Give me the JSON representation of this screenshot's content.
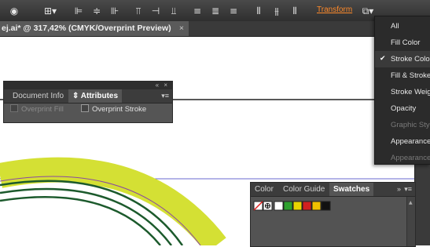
{
  "toolbar": {
    "transform_label": "Transform",
    "icons": [
      "globe-icon",
      "arrange-icon",
      "align-left-icon",
      "align-hcenter-icon",
      "align-right-icon",
      "align-top-icon",
      "align-vcenter-icon",
      "align-bottom-icon",
      "distribute-top-icon",
      "distribute-vcenter-icon",
      "distribute-bottom-icon",
      "distribute-left-icon",
      "distribute-hcenter-icon",
      "distribute-right-icon",
      "transform-options-icon"
    ]
  },
  "document": {
    "tab_title": "ej.ai* @ 317,42% (CMYK/Overprint Preview)",
    "close_glyph": "×"
  },
  "attributes_panel": {
    "tabs": [
      "Document Info",
      "Attributes"
    ],
    "active_tab": "Attributes",
    "overprint_fill_label": "Overprint Fill",
    "overprint_fill_enabled": false,
    "overprint_stroke_label": "Overprint Stroke",
    "overprint_stroke_checked": false
  },
  "dropdown_menu": {
    "items": [
      {
        "label": "All",
        "checked": false,
        "disabled": false
      },
      {
        "label": "Fill Color",
        "checked": false,
        "disabled": false
      },
      {
        "label": "Stroke Color",
        "checked": true,
        "disabled": false
      },
      {
        "label": "Fill & Stroke",
        "checked": false,
        "disabled": false
      },
      {
        "label": "Stroke Weight",
        "checked": false,
        "disabled": false
      },
      {
        "label": "Opacity",
        "checked": false,
        "disabled": false
      },
      {
        "label": "Graphic Style",
        "checked": false,
        "disabled": true
      },
      {
        "label": "Appearance",
        "checked": false,
        "disabled": false
      },
      {
        "label": "Appearance Attribute",
        "checked": false,
        "disabled": true
      }
    ]
  },
  "swatches_panel": {
    "tabs": [
      "Color",
      "Color Guide",
      "Swatches"
    ],
    "active_tab": "Swatches",
    "swatch_colors": [
      "#ffffff",
      "#d0d0d0",
      "#2ea02e",
      "#e8d400",
      "#d02020",
      "#f0c000",
      "#111111"
    ]
  },
  "colors": {
    "ui_dark": "#2f2f2f",
    "panel": "#555555",
    "accent_link": "#ff8a2a",
    "artwork_lime": "#d4e034",
    "artwork_green": "#1c5a2c"
  }
}
